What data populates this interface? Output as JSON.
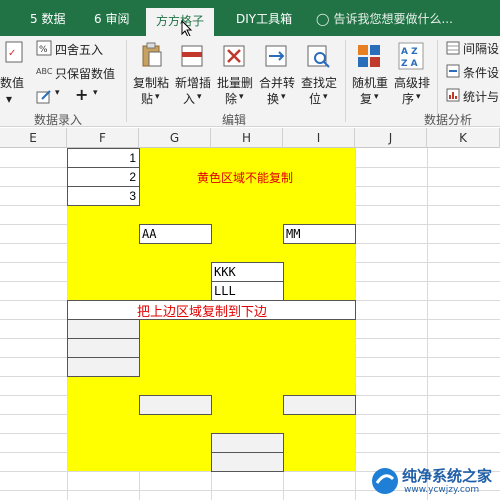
{
  "tabs": [
    {
      "label": "5 数据"
    },
    {
      "label": "6 审阅"
    },
    {
      "label": "方方格子",
      "active": true
    },
    {
      "label": "DIY工具箱"
    }
  ],
  "tell_me": "告诉我您想要做什么...",
  "ribbon": {
    "data_entry": {
      "numeric_label": "数值",
      "round_label": "四舍五入",
      "keep_value_label": "只保留数值",
      "plus_label": "+",
      "group_label": "数据录入"
    },
    "edit": {
      "copy_paste_l1": "复制粘",
      "copy_paste_l2": "贴",
      "insert_l1": "新增插",
      "insert_l2": "入",
      "batch_delete_l1": "批量删",
      "batch_delete_l2": "除",
      "merge_l1": "合并转",
      "merge_l2": "换",
      "find_l1": "查找定",
      "find_l2": "位",
      "group_label": "编辑"
    },
    "analysis": {
      "random_l1": "随机重",
      "random_l2": "复",
      "sort_l1": "高级排",
      "sort_l2": "序",
      "interval_label": "间隔设",
      "cond_label": "条件设",
      "stats_label": "统计与",
      "group_label": "数据分析"
    }
  },
  "columns": [
    "E",
    "F",
    "G",
    "H",
    "I",
    "J",
    "K"
  ],
  "sheet": {
    "numbers": [
      "1",
      "2",
      "3"
    ],
    "note_top": "黄色区域不能复制",
    "note_middle": "把上边区域复制到下边",
    "cell_aa": "AA",
    "cell_mm": "MM",
    "cell_kkk": "KKK",
    "cell_lll": "LLL"
  },
  "colors": {
    "accent": "#217346",
    "yellow": "#FFFF00",
    "red": "#E00000"
  },
  "watermark": {
    "main": "纯净系统之家",
    "url": "www.ycwjzy.com"
  }
}
